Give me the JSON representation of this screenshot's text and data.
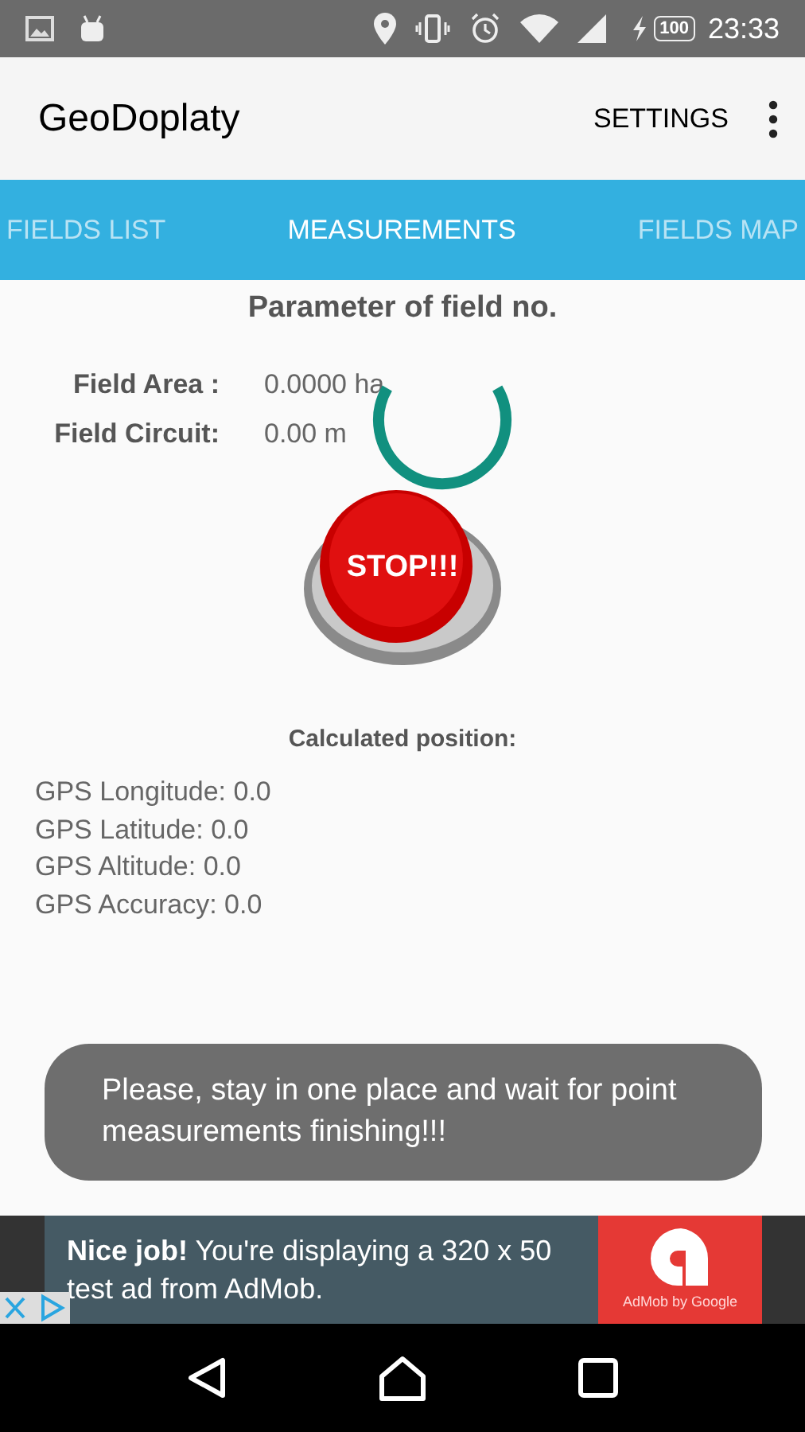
{
  "status_bar": {
    "time": "23:33",
    "battery": "100"
  },
  "app_bar": {
    "title": "GeoDoplaty",
    "action": "SETTINGS"
  },
  "tabs": [
    {
      "label": "FIELDS LIST",
      "selected": false
    },
    {
      "label": "MEASUREMENTS",
      "selected": true
    },
    {
      "label": "FIELDS MAP",
      "selected": false
    }
  ],
  "heading": "Parameter of field no.",
  "fields": [
    {
      "label": "Field Area :",
      "value": "0.0000 ha"
    },
    {
      "label": "Field Circuit:",
      "value": "0.00 m"
    }
  ],
  "stop_button": "STOP!!!",
  "position": {
    "title": "Calculated position:",
    "lines": [
      "GPS Longitude: 0.0",
      "GPS Latitude: 0.0",
      "GPS Altitude: 0.0",
      "GPS Accuracy: 0.0"
    ]
  },
  "toast": "Please, stay in one place and wait for point measurements finishing!!!",
  "ad": {
    "text": "**Nice job!** You're displaying a 320 x 50 test ad from AdMob.",
    "brand": "AdMob by Google"
  }
}
